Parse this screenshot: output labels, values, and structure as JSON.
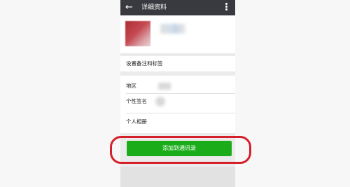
{
  "topbar": {
    "back_icon": "←",
    "title": "详细资料",
    "more_icon": "more-vertical-icon"
  },
  "profile": {
    "name": ""
  },
  "remark_row": {
    "label": "设置备注和标签"
  },
  "info": {
    "region_label": "地区",
    "signature_label": "个性签名",
    "album_label": "个人相册"
  },
  "actions": {
    "add_contact_label": "添加到通讯录"
  },
  "colors": {
    "topbar": "#393a3f",
    "primary_button": "#1aad19",
    "highlight": "#d5202b"
  }
}
